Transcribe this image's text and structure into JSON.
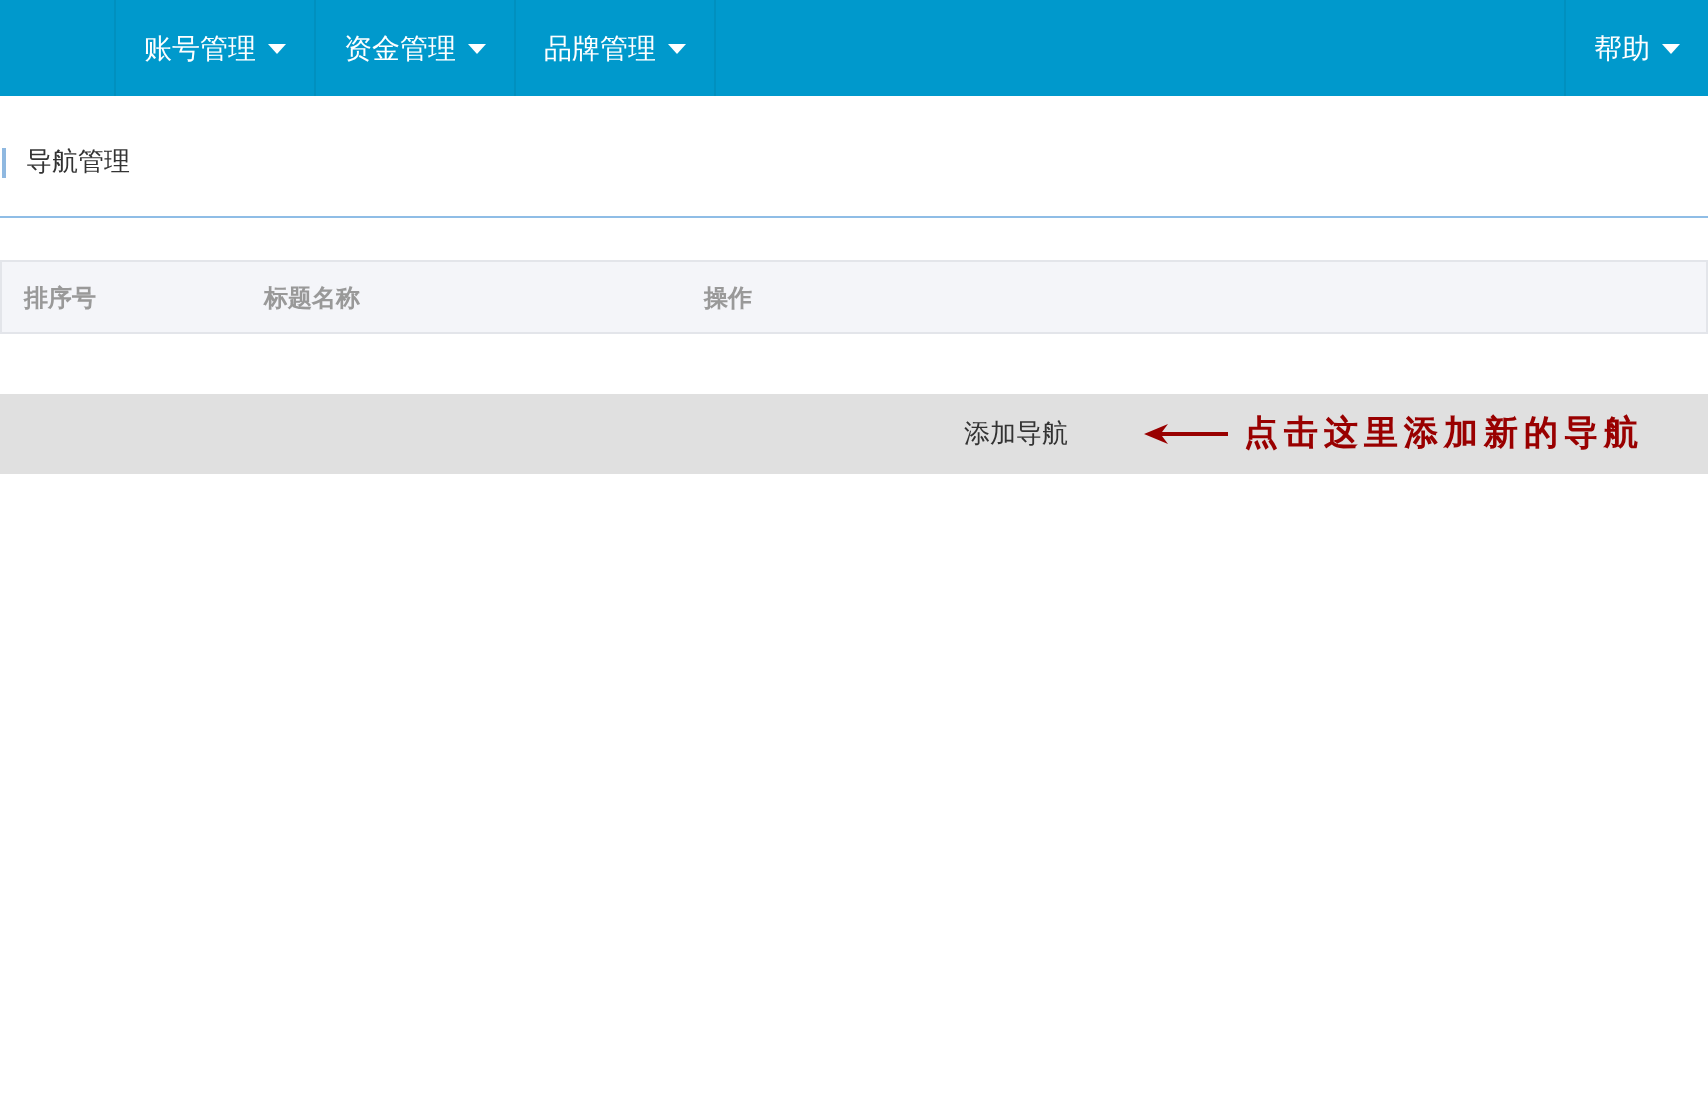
{
  "navbar": {
    "menus": [
      {
        "label": "账号管理"
      },
      {
        "label": "资金管理"
      },
      {
        "label": "品牌管理"
      }
    ],
    "right_menus": [
      {
        "label": "帮助"
      }
    ]
  },
  "page": {
    "title": "导航管理"
  },
  "table": {
    "columns": [
      "排序号",
      "标题名称",
      "操作"
    ]
  },
  "action_bar": {
    "button": "添加导航",
    "annotation": "点击这里添加新的导航"
  }
}
